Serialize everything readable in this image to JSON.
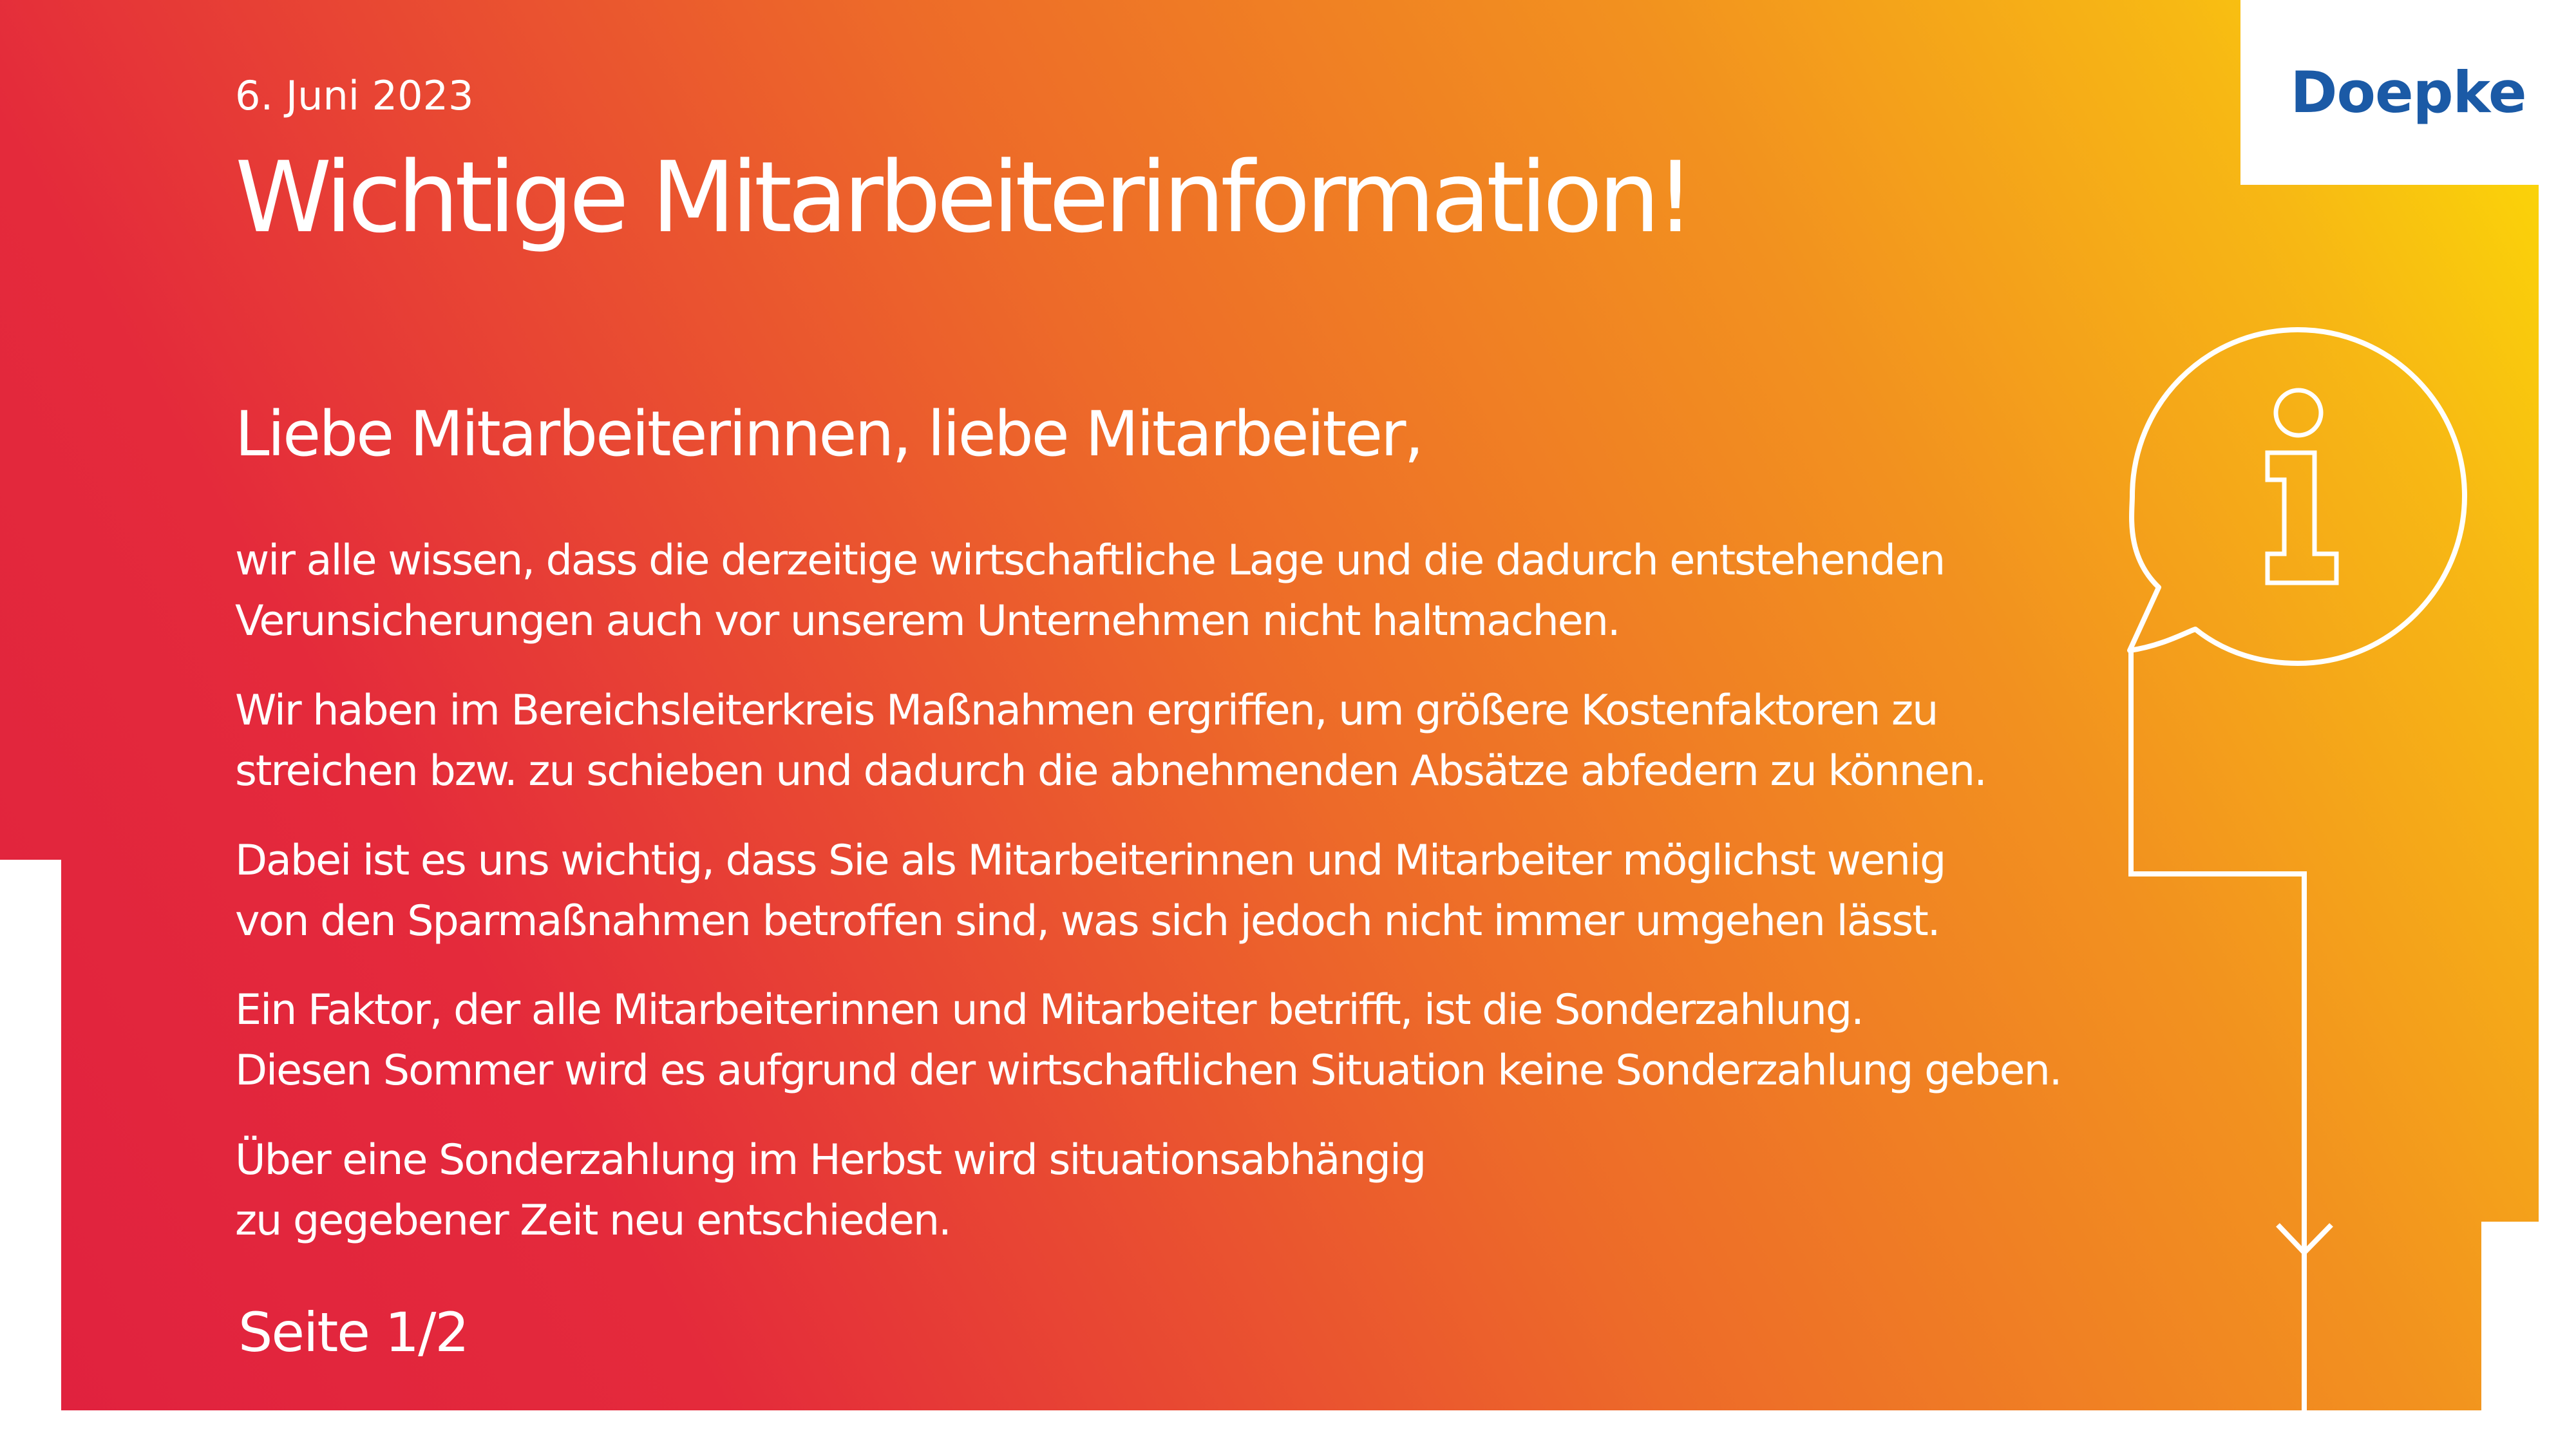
{
  "header": {
    "date": "6. Juni 2023",
    "headline": "Wichtige Mitarbeiterinformation!"
  },
  "logo": {
    "text": "Doepke",
    "color": "#1b5aa6"
  },
  "body": {
    "greeting": "Liebe Mitarbeiterinnen, liebe Mitarbeiter,",
    "paragraphs": [
      [
        "wir alle wissen, dass die derzeitige wirtschaftliche Lage und die dadurch entstehenden",
        "Verunsicherungen auch vor unserem Unternehmen nicht haltmachen."
      ],
      [
        "Wir haben im Bereichsleiterkreis Maßnahmen ergriffen, um größere Kostenfaktoren zu",
        "streichen bzw. zu schieben und dadurch die abnehmenden Absätze abfedern zu können."
      ],
      [
        "Dabei ist es uns wichtig, dass Sie als Mitarbeiterinnen und Mitarbeiter möglichst wenig",
        "von den Sparmaßnahmen betroffen sind, was sich jedoch nicht immer umgehen lässt."
      ],
      [
        "Ein Faktor, der alle Mitarbeiterinnen und Mitarbeiter betrifft, ist die Sonderzahlung.",
        "Diesen Sommer wird es aufgrund der wirtschaftlichen Situation keine Sonderzahlung geben."
      ],
      [
        "Über eine Sonderzahlung im Herbst wird situationsabhängig",
        "zu gegebener Zeit neu entschieden."
      ]
    ]
  },
  "footer": {
    "page_number": "Seite 1/2"
  },
  "icons": {
    "info": "info-speech-bubble-icon",
    "arrow": "arrow-down-icon"
  },
  "colors": {
    "gradient_red": "#e4203d",
    "gradient_orange": "#f08a22",
    "gradient_yellow": "#fbdc05",
    "text": "#ffffff"
  }
}
